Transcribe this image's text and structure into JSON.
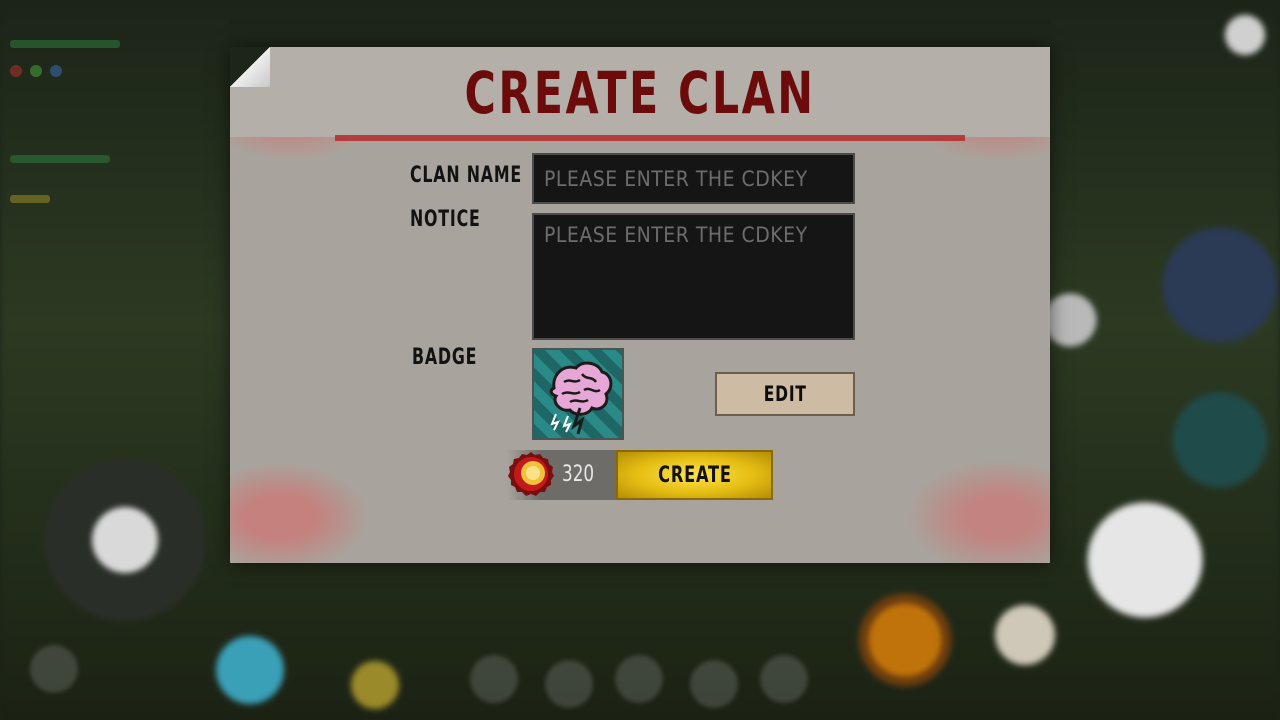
{
  "dialog": {
    "title": "CREATE CLAN"
  },
  "form": {
    "clan_name_label": "CLAN NAME",
    "clan_name_placeholder": "PLEASE ENTER THE CDKEY",
    "clan_name_value": "",
    "notice_label": "NOTICE",
    "notice_placeholder": "PLEASE ENTER THE CDKEY",
    "notice_value": "",
    "badge_label": "BADGE",
    "badge_icon": "brain-icon",
    "edit_label": "EDIT"
  },
  "footer": {
    "cost_icon": "bottle-cap-coin-icon",
    "cost_value": "320",
    "create_label": "CREATE"
  },
  "colors": {
    "title": "#6b0b0b",
    "create_button": "#e4bd12",
    "edit_button": "#cdbba3",
    "panel": "#a8a49d"
  }
}
